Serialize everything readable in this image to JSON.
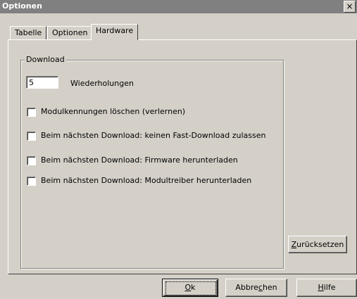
{
  "window": {
    "title": "Optionen",
    "close_glyph": "×"
  },
  "tabs": [
    {
      "label": "Tabelle",
      "selected": false
    },
    {
      "label": "Optionen",
      "selected": false
    },
    {
      "label": "Hardware",
      "selected": true
    }
  ],
  "download": {
    "group_label": "Download",
    "retries_value": "5",
    "retries_label": "Wiederholungen",
    "options": [
      {
        "label": "Modulkennungen löschen (verlernen)",
        "checked": false
      },
      {
        "label": "Beim nächsten Download: keinen Fast-Download zulassen",
        "checked": false
      },
      {
        "label": "Beim nächsten Download: Firmware herunterladen",
        "checked": false
      },
      {
        "label": "Beim nächsten Download: Modultreiber herunterladen",
        "checked": false
      }
    ]
  },
  "buttons": {
    "reset": {
      "mnemonic": "Z",
      "rest": "urücksetzen"
    },
    "ok": {
      "mnemonic": "O",
      "rest": "k"
    },
    "cancel": {
      "pre": "Abbre",
      "mnemonic": "c",
      "rest": "hen"
    },
    "help": {
      "mnemonic": "H",
      "rest": "ilfe"
    }
  }
}
